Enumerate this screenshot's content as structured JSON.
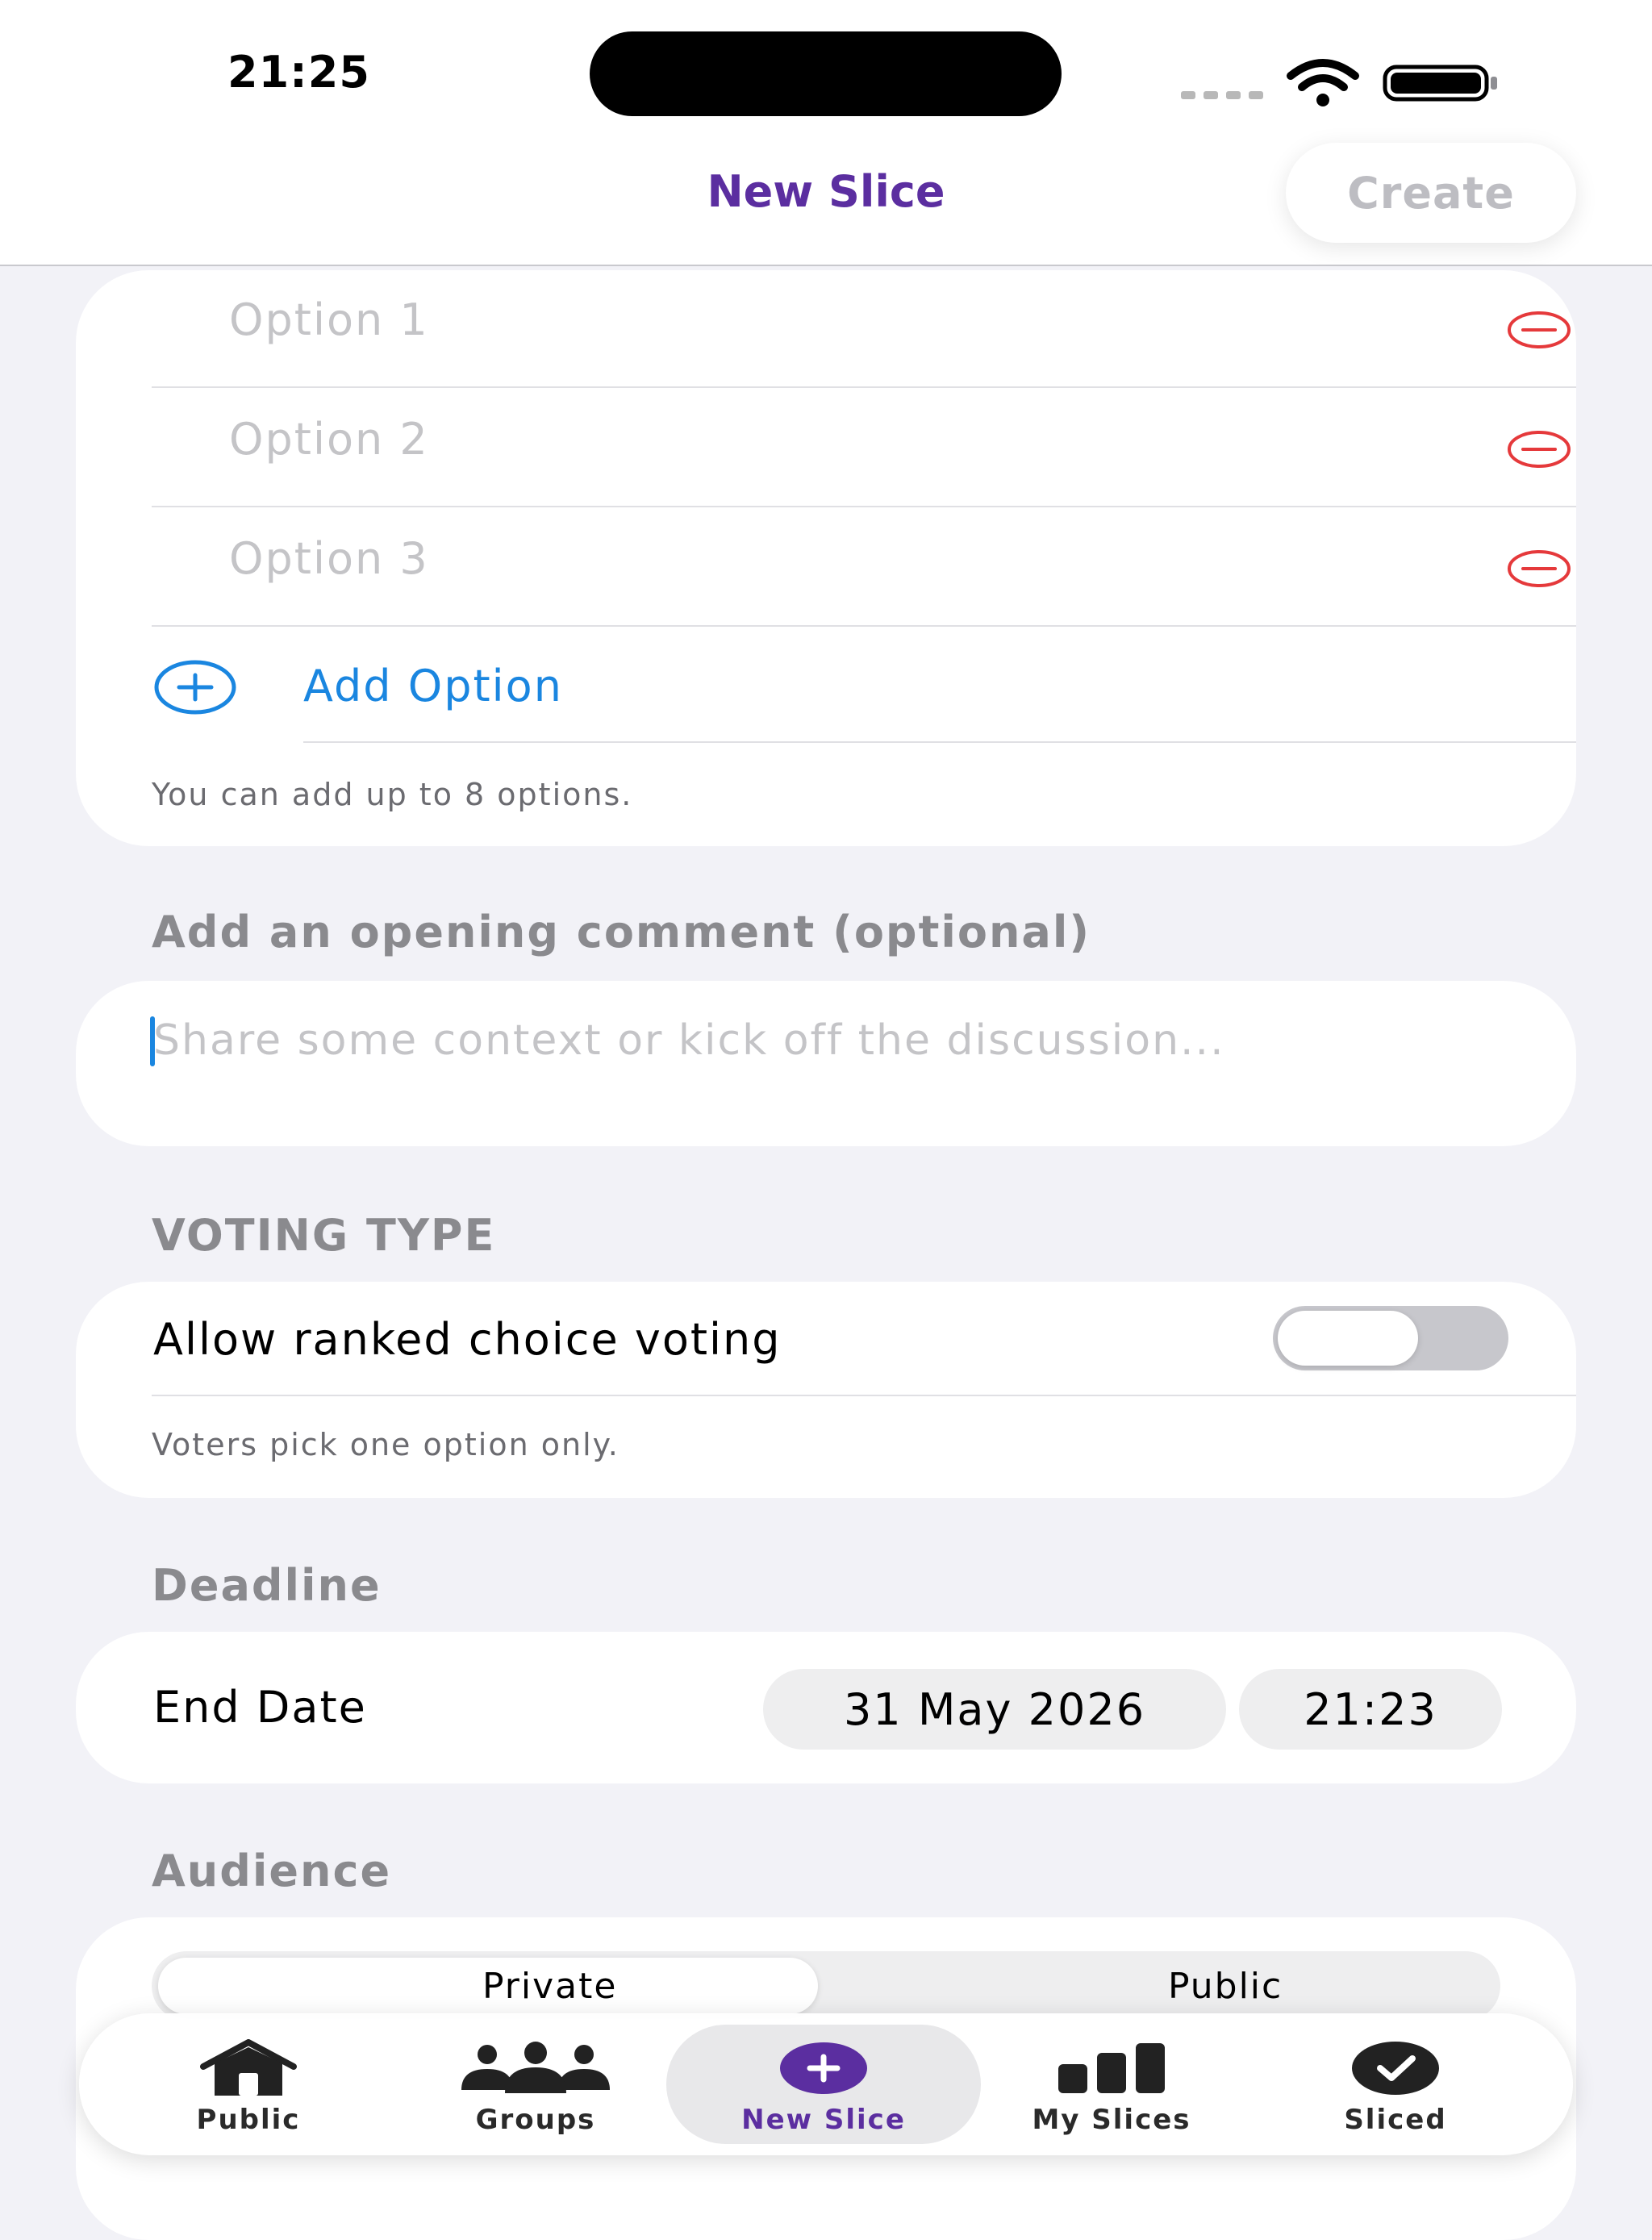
{
  "status_bar": {
    "time": "21:25"
  },
  "nav": {
    "title": "New Slice",
    "create_label": "Create"
  },
  "options": {
    "items": [
      {
        "placeholder": "Option 1"
      },
      {
        "placeholder": "Option 2"
      },
      {
        "placeholder": "Option 3"
      }
    ],
    "add_label": "Add Option",
    "hint": "You can add up to 8 options."
  },
  "comment": {
    "section_label": "Add an opening comment (optional)",
    "placeholder": "Share some context or kick off the discussion..."
  },
  "voting": {
    "section_label": "VOTING TYPE",
    "toggle_label": "Allow ranked choice voting",
    "toggle_on": false,
    "hint": "Voters pick one option only."
  },
  "deadline": {
    "section_label": "Deadline",
    "end_label": "End Date",
    "date": "31 May 2026",
    "time": "21:23"
  },
  "audience": {
    "section_label": "Audience",
    "segments": [
      "Private",
      "Public"
    ],
    "selected": "Private"
  },
  "tabbar": {
    "tabs": [
      {
        "label": "Public",
        "icon": "house-icon"
      },
      {
        "label": "Groups",
        "icon": "people-icon"
      },
      {
        "label": "New Slice",
        "icon": "plus-circle-icon"
      },
      {
        "label": "My Slices",
        "icon": "bar-chart-icon"
      },
      {
        "label": "Sliced",
        "icon": "checkmark-circle-icon"
      }
    ],
    "selected": "New Slice"
  },
  "colors": {
    "accent_purple": "#5b2ea0",
    "link_blue": "#1a86e0",
    "destructive_red": "#e5393b",
    "background": "#f2f2f7"
  }
}
